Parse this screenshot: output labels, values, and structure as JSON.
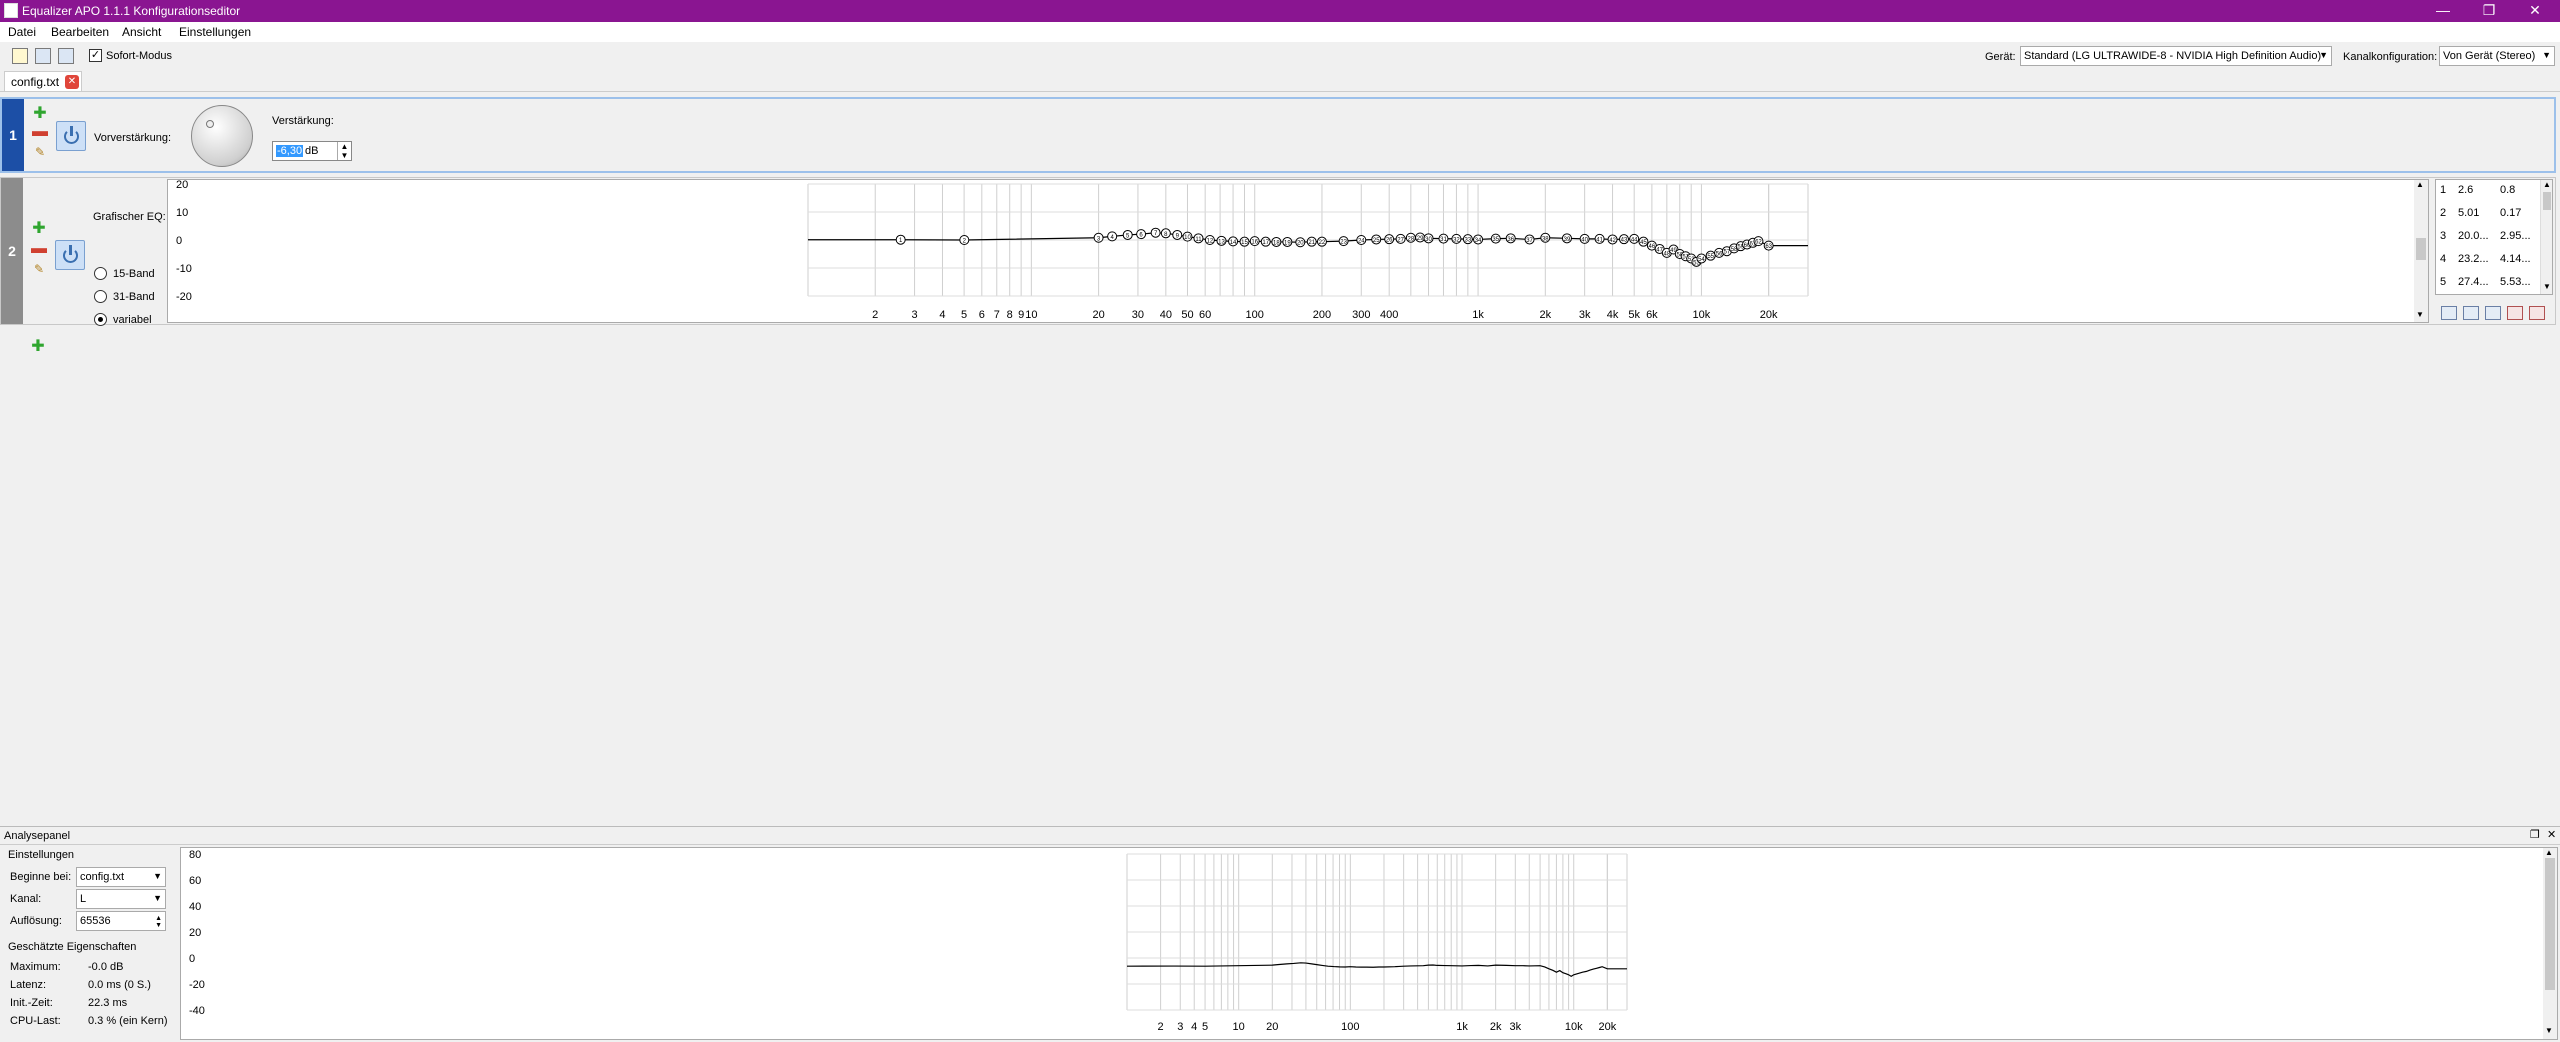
{
  "window": {
    "title": "Equalizer APO 1.1.1 Konfigurationseditor",
    "btn_min": "—",
    "btn_max": "❐",
    "btn_close": "✕"
  },
  "menu": {
    "file": "Datei",
    "edit": "Bearbeiten",
    "view": "Ansicht",
    "settings": "Einstellungen"
  },
  "toolbar": {
    "instant_mode_label": "Sofort-Modus",
    "instant_mode_checked": "✓",
    "device_label": "Gerät:",
    "device_value": "Standard (LG ULTRAWIDE-8 - NVIDIA High Definition Audio)",
    "channel_label": "Kanalkonfiguration:",
    "channel_value": "Von Gerät (Stereo)"
  },
  "tab": {
    "name": "config.txt",
    "close": "✕"
  },
  "filter1": {
    "number": "1",
    "preamp_label": "Vorverstärkung:",
    "gain_label": "Verstärkung:",
    "gain_value": "-6,30",
    "gain_unit": "dB"
  },
  "filter2": {
    "number": "2",
    "title": "Grafischer EQ:",
    "radio_15": "15-Band",
    "radio_31": "31-Band",
    "radio_var": "variabel",
    "y_ticks": [
      "20",
      "10",
      "0",
      "-10",
      "-20"
    ],
    "x_ticks": [
      "2",
      "3",
      "4",
      "5",
      "6",
      "7",
      "8",
      "9",
      "10",
      "20",
      "30",
      "40",
      "50",
      "60",
      "100",
      "200",
      "300",
      "400",
      "1k",
      "2k",
      "3k",
      "4k",
      "5k",
      "6k",
      "10k",
      "20k"
    ],
    "table": [
      [
        "1",
        "2.6",
        "0.8"
      ],
      [
        "2",
        "5.01",
        "0.17"
      ],
      [
        "3",
        "20.0...",
        "2.95..."
      ],
      [
        "4",
        "23.2...",
        "4.14..."
      ],
      [
        "5",
        "27.4...",
        "5.53..."
      ]
    ]
  },
  "eq_points": [
    [
      2.6,
      0.1
    ],
    [
      5.01,
      0
    ],
    [
      20,
      0.8
    ],
    [
      23,
      1.3
    ],
    [
      27,
      1.8
    ],
    [
      31,
      2.1
    ],
    [
      36,
      2.6
    ],
    [
      40,
      2.4
    ],
    [
      45,
      1.8
    ],
    [
      50,
      1.2
    ],
    [
      56,
      0.6
    ],
    [
      63,
      0
    ],
    [
      71,
      -0.3
    ],
    [
      80,
      -0.5
    ],
    [
      90,
      -0.6
    ],
    [
      100,
      -0.4
    ],
    [
      112,
      -0.6
    ],
    [
      125,
      -0.7
    ],
    [
      140,
      -0.7
    ],
    [
      160,
      -0.8
    ],
    [
      180,
      -0.6
    ],
    [
      200,
      -0.6
    ],
    [
      250,
      -0.4
    ],
    [
      300,
      0
    ],
    [
      350,
      0.2
    ],
    [
      400,
      0.3
    ],
    [
      450,
      0.4
    ],
    [
      500,
      0.8
    ],
    [
      550,
      0.9
    ],
    [
      600,
      0.6
    ],
    [
      700,
      0.5
    ],
    [
      800,
      0.4
    ],
    [
      900,
      0.3
    ],
    [
      1000,
      0.2
    ],
    [
      1200,
      0.5
    ],
    [
      1400,
      0.6
    ],
    [
      1700,
      0.2
    ],
    [
      2000,
      0.8
    ],
    [
      2500,
      0.6
    ],
    [
      3000,
      0.4
    ],
    [
      3500,
      0.4
    ],
    [
      4000,
      0.2
    ],
    [
      4500,
      0.3
    ],
    [
      5000,
      0.4
    ],
    [
      5500,
      -0.6
    ],
    [
      6000,
      -2.0
    ],
    [
      6500,
      -3.2
    ],
    [
      7000,
      -4.6
    ],
    [
      7500,
      -3.4
    ],
    [
      8000,
      -5.0
    ],
    [
      8500,
      -5.8
    ],
    [
      9000,
      -6.6
    ],
    [
      9500,
      -7.8
    ],
    [
      10000,
      -6.6
    ],
    [
      11000,
      -5.6
    ],
    [
      12000,
      -4.6
    ],
    [
      13000,
      -4.0
    ],
    [
      14000,
      -3.0
    ],
    [
      15000,
      -2.2
    ],
    [
      16000,
      -1.6
    ],
    [
      17000,
      -1.0
    ],
    [
      18000,
      -0.4
    ],
    [
      20000,
      -2.0
    ]
  ],
  "analysis": {
    "title": "Analysepanel",
    "settings_title": "Einstellungen",
    "start_label": "Beginne bei:",
    "start_value": "config.txt",
    "channel_label": "Kanal:",
    "channel_value": "L",
    "resolution_label": "Auflösung:",
    "resolution_value": "65536",
    "props_title": "Geschätzte Eigenschaften",
    "max_label": "Maximum:",
    "max_value": "-0.0 dB",
    "latency_label": "Latenz:",
    "latency_value": "0.0 ms (0 S.)",
    "init_label": "Init.-Zeit:",
    "init_value": "22.3 ms",
    "cpu_label": "CPU-Last:",
    "cpu_value": "0.3 % (ein Kern)",
    "y_ticks": [
      "80",
      "60",
      "40",
      "20",
      "0",
      "-20",
      "-40"
    ],
    "x_ticks": [
      "2",
      "3",
      "4",
      "5",
      "10",
      "20",
      "100",
      "1k",
      "2k",
      "3k",
      "10k",
      "20k"
    ]
  },
  "colors": {
    "titlebar": "#8a1591",
    "filter1_stripe": "#1c4fa6",
    "filter2_stripe": "#8c8c8c",
    "selection": "#3399ff"
  }
}
